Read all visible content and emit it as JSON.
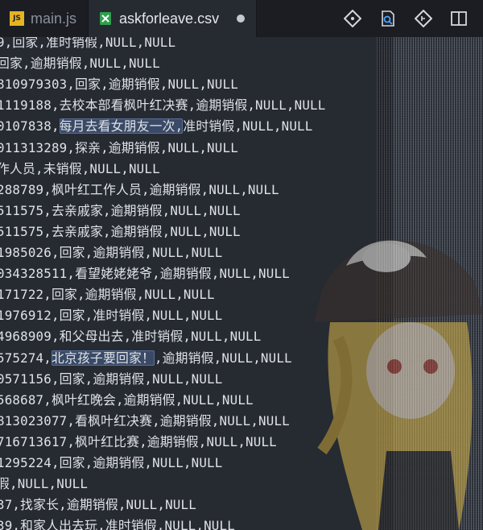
{
  "tabs": [
    {
      "label": "main.js",
      "icon": "js-file-icon",
      "active": false
    },
    {
      "label": "askforleave.csv",
      "icon": "csv-file-icon",
      "active": true,
      "modified": true
    }
  ],
  "js_badge": "JS",
  "actions": [
    "git-icon",
    "search-file-icon",
    "git-branch-icon",
    "split-editor-icon"
  ],
  "lines": [
    {
      "pre": "9,回家,准时销假,NULL,NULL",
      "sel": "",
      "post": ""
    },
    {
      "pre": "回家,逾期销假,NULL,NULL",
      "sel": "",
      "post": ""
    },
    {
      "pre": "810979303,回家,逾期销假,NULL,NULL",
      "sel": "",
      "post": ""
    },
    {
      "pre": "1119188,去校本部看枫叶红决赛,逾期销假,NULL,NULL",
      "sel": "",
      "post": ""
    },
    {
      "pre": "0107838,",
      "sel": "每月去看女朋友一次,",
      "post": "准时销假,NULL,NULL"
    },
    {
      "pre": "011313289,探亲,逾期销假,NULL,NULL",
      "sel": "",
      "post": ""
    },
    {
      "pre": "作人员,未销假,NULL,NULL",
      "sel": "",
      "post": ""
    },
    {
      "pre": "288789,枫叶红工作人员,逾期销假,NULL,NULL",
      "sel": "",
      "post": ""
    },
    {
      "pre": "511575,去亲戚家,逾期销假,NULL,NULL",
      "sel": "",
      "post": ""
    },
    {
      "pre": "511575,去亲戚家,逾期销假,NULL,NULL",
      "sel": "",
      "post": ""
    },
    {
      "pre": "1985026,回家,逾期销假,NULL,NULL",
      "sel": "",
      "post": ""
    },
    {
      "pre": "034328511,看望姥姥姥爷,逾期销假,NULL,NULL",
      "sel": "",
      "post": ""
    },
    {
      "pre": "171722,回家,逾期销假,NULL,NULL",
      "sel": "",
      "post": ""
    },
    {
      "pre": "1976912,回家,准时销假,NULL,NULL",
      "sel": "",
      "post": ""
    },
    {
      "pre": "4968909,和父母出去,准时销假,NULL,NULL",
      "sel": "",
      "post": ""
    },
    {
      "pre": "575274,",
      "sel": "北京孩子要回家！",
      "post": ",逾期销假,NULL,NULL"
    },
    {
      "pre": "0571156,回家,逾期销假,NULL,NULL",
      "sel": "",
      "post": ""
    },
    {
      "pre": "568687,枫叶红晚会,逾期销假,NULL,NULL",
      "sel": "",
      "post": ""
    },
    {
      "pre": "813023077,看枫叶红决赛,逾期销假,NULL,NULL",
      "sel": "",
      "post": ""
    },
    {
      "pre": "716713617,枫叶红比赛,逾期销假,NULL,NULL",
      "sel": "",
      "post": ""
    },
    {
      "pre": "1295224,回家,逾期销假,NULL,NULL",
      "sel": "",
      "post": ""
    },
    {
      "pre": "假,NULL,NULL",
      "sel": "",
      "post": ""
    },
    {
      "pre": "37,找家长,逾期销假,NULL,NULL",
      "sel": "",
      "post": ""
    },
    {
      "pre": "39,和家人出去玩,准时销假,NULL,NULL",
      "sel": "",
      "post": ""
    }
  ],
  "colors": {
    "editor_bg": "#262a31",
    "tabbar_bg": "#1b1d23",
    "text": "#dfe2e8",
    "selection": "#3a4a66",
    "js_icon": "#e6b422",
    "csv_icon": "#2e9f4e"
  }
}
